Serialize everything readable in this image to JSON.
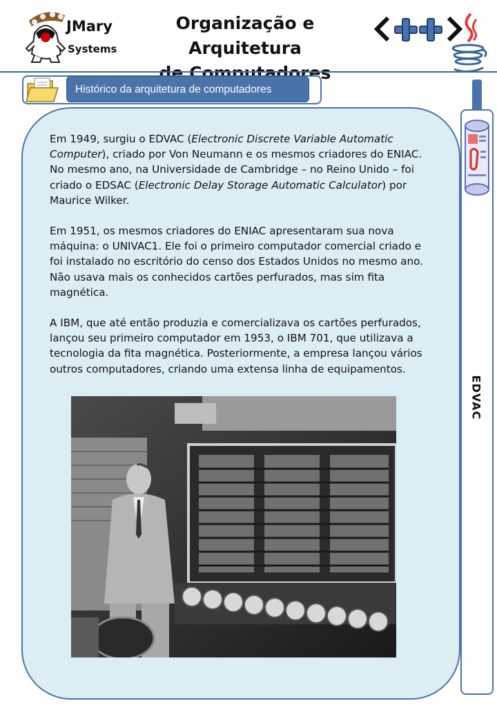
{
  "header": {
    "brand_line1": "JMary",
    "brand_line2": "Systems",
    "title_line1": "Organização e Arquitetura",
    "title_line2": "de Computadores"
  },
  "section": {
    "label": "Histórico da arquitetura de computadores"
  },
  "sidebar": {
    "label": "EDVAC"
  },
  "content": {
    "p1_a": "Em 1949, surgiu o EDVAC (",
    "p1_b": "Electronic Discrete Variable Automatic Computer",
    "p1_c": "), criado por Von Neumann e os mesmos criadores do ENIAC. No mesmo ano, na Universidade de Cambridge – no Reino Unido – foi criado o EDSAC (",
    "p1_d": "Electronic Delay Storage Automatic Calculator",
    "p1_e": ") por Maurice Wilker.",
    "p2": "Em 1951, os mesmos criadores do ENIAC apresentaram sua nova máquina: o UNIVAC1. Ele foi o primeiro computador comercial criado e foi instalado no escritório do censo dos Estados Unidos no mesmo ano. Não usava mais os conhecidos cartões perfurados, mas sim fita magnética.",
    "p3": "A IBM, que até então produzia e comercializava os cartões perfurados, lançou seu primeiro computador em 1953, o IBM 701, que utilizava a tecnologia da fita magnética. Posteriormente, a empresa lançou vários outros computadores, criando uma extensa linha de equipamentos."
  },
  "colors": {
    "accent": "#4a73ab",
    "panel_bg": "#dbeef4"
  },
  "icons": {
    "brand": "java-duke-mascot-icon",
    "cpp": "cpp-logo-icon",
    "java": "java-cup-icon",
    "folder": "folder-icon",
    "sidebar": "newspaper-scroll-icon"
  }
}
